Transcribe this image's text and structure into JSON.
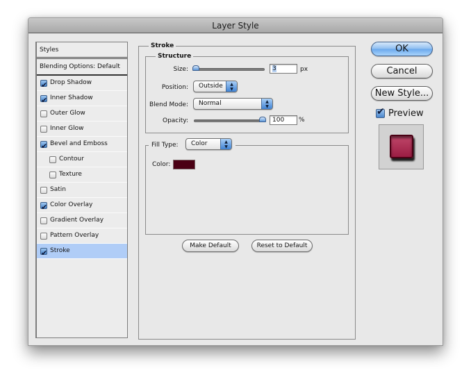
{
  "window": {
    "title": "Layer Style"
  },
  "styles_list": {
    "header": "Styles",
    "blending_options": "Blending Options: Default",
    "items": [
      {
        "label": "Drop Shadow",
        "checked": true,
        "sub": false,
        "selected": false
      },
      {
        "label": "Inner Shadow",
        "checked": true,
        "sub": false,
        "selected": false
      },
      {
        "label": "Outer Glow",
        "checked": false,
        "sub": false,
        "selected": false
      },
      {
        "label": "Inner Glow",
        "checked": false,
        "sub": false,
        "selected": false
      },
      {
        "label": "Bevel and Emboss",
        "checked": true,
        "sub": false,
        "selected": false
      },
      {
        "label": "Contour",
        "checked": false,
        "sub": true,
        "selected": false
      },
      {
        "label": "Texture",
        "checked": false,
        "sub": true,
        "selected": false
      },
      {
        "label": "Satin",
        "checked": false,
        "sub": false,
        "selected": false
      },
      {
        "label": "Color Overlay",
        "checked": true,
        "sub": false,
        "selected": false
      },
      {
        "label": "Gradient Overlay",
        "checked": false,
        "sub": false,
        "selected": false
      },
      {
        "label": "Pattern Overlay",
        "checked": false,
        "sub": false,
        "selected": false
      },
      {
        "label": "Stroke",
        "checked": true,
        "sub": false,
        "selected": true
      }
    ]
  },
  "stroke": {
    "title": "Stroke",
    "structure": {
      "title": "Structure",
      "size_label": "Size:",
      "size_value": "3",
      "size_unit": "px",
      "size_slider_fraction": 0.0,
      "position_label": "Position:",
      "position_value": "Outside",
      "blend_mode_label": "Blend Mode:",
      "blend_mode_value": "Normal",
      "opacity_label": "Opacity:",
      "opacity_value": "100",
      "opacity_unit": "%",
      "opacity_slider_fraction": 1.0
    },
    "fill": {
      "fill_type_label": "Fill Type:",
      "fill_type_value": "Color",
      "color_label": "Color:",
      "color_value": "#4a0014"
    },
    "make_default": "Make Default",
    "reset_to_default": "Reset to Default"
  },
  "side": {
    "ok": "OK",
    "cancel": "Cancel",
    "new_style": "New Style...",
    "preview_label": "Preview",
    "preview_checked": true
  }
}
